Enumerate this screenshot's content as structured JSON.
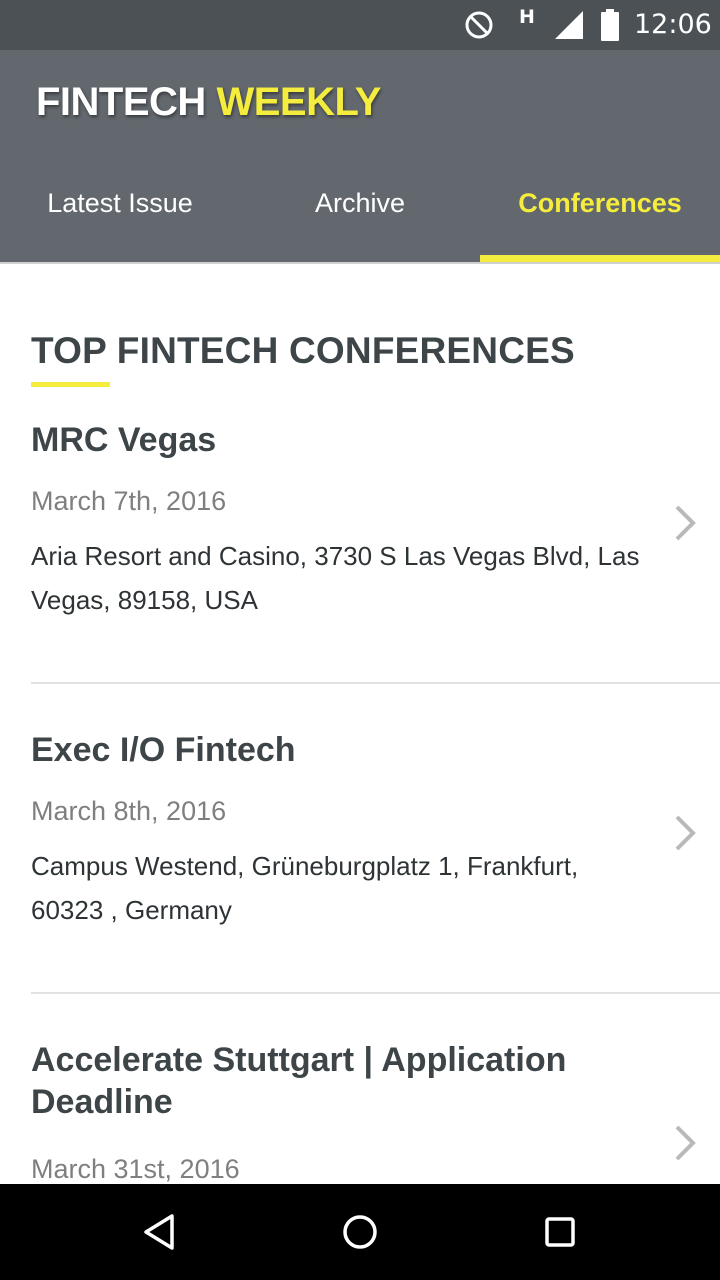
{
  "status_bar": {
    "network_type": "H",
    "time": "12:06",
    "icons": [
      "do-not-disturb-icon",
      "network-h-icon",
      "signal-icon",
      "battery-icon"
    ]
  },
  "header": {
    "brand_part1": "FINTECH",
    "brand_part2": "WEEKLY",
    "tabs": [
      {
        "label": "Latest Issue",
        "active": false
      },
      {
        "label": "Archive",
        "active": false
      },
      {
        "label": "Conferences",
        "active": true
      }
    ]
  },
  "colors": {
    "status_bar": "#4b5155",
    "header": "#62686d",
    "accent_yellow": "#f5ed3d",
    "title_text": "#3e4549",
    "date_text": "#7d7f81"
  },
  "section": {
    "title": "TOP FINTECH CONFERENCES"
  },
  "conferences": [
    {
      "title": "MRC Vegas",
      "date": "March 7th, 2016",
      "address": "Aria Resort and Casino, 3730 S Las Vegas Blvd, Las Vegas, 89158, USA"
    },
    {
      "title": "Exec I/O Fintech",
      "date": "March 8th, 2016",
      "address": "Campus Westend, Grüneburgplatz 1, Frankfurt, 60323 , Germany"
    },
    {
      "title": "Accelerate Stuttgart | Application Deadline",
      "date": "March 31st, 2016",
      "address": ""
    }
  ],
  "nav_bar": {
    "buttons": [
      "back-icon",
      "home-icon",
      "recents-icon"
    ]
  }
}
